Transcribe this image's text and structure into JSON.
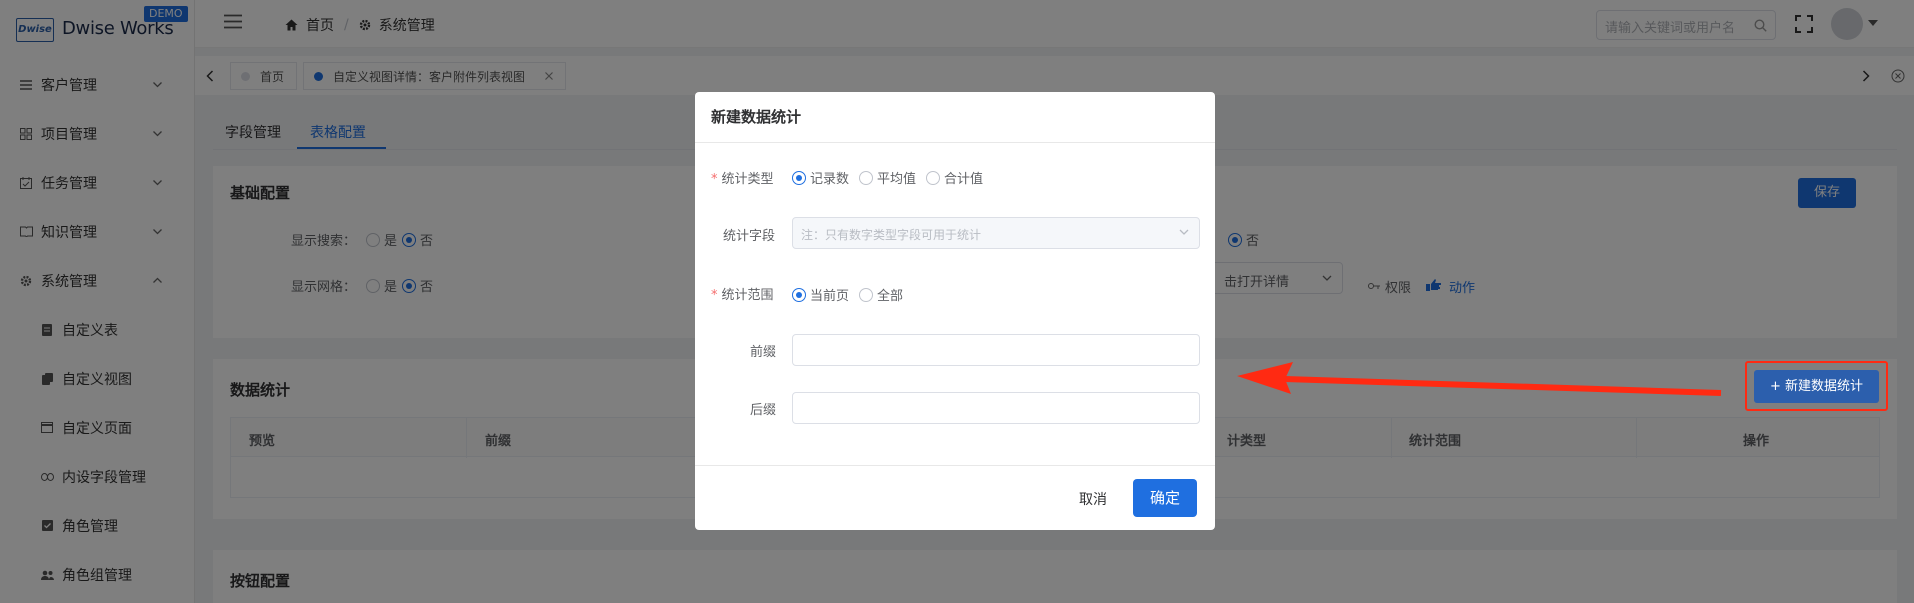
{
  "app": {
    "logo_mark": "Dwise",
    "logo_name": "Dwise Works",
    "badge": "DEMO"
  },
  "sidebar": {
    "items": [
      {
        "label": "客户管理",
        "icon": "list-icon",
        "expanded": false
      },
      {
        "label": "项目管理",
        "icon": "grid-icon",
        "expanded": false
      },
      {
        "label": "任务管理",
        "icon": "calendar-check-icon",
        "expanded": false
      },
      {
        "label": "知识管理",
        "icon": "book-icon",
        "expanded": false
      },
      {
        "label": "系统管理",
        "icon": "gear-icon",
        "expanded": true
      }
    ],
    "subitems": [
      {
        "label": "自定义表",
        "icon": "file-icon"
      },
      {
        "label": "自定义视图",
        "icon": "copy-icon"
      },
      {
        "label": "自定义页面",
        "icon": "window-icon"
      },
      {
        "label": "内设字段管理",
        "icon": "link-icon"
      },
      {
        "label": "角色管理",
        "icon": "checkbox-icon"
      },
      {
        "label": "角色组管理",
        "icon": "users-icon"
      }
    ]
  },
  "header": {
    "breadcrumb": [
      "首页",
      "系统管理"
    ],
    "search_placeholder": "请输入关键词或用户名"
  },
  "tabs": [
    {
      "label": "首页"
    },
    {
      "label": "自定义视图详情：客户附件列表视图"
    }
  ],
  "subtabs": [
    "字段管理",
    "表格配置"
  ],
  "basic": {
    "title": "基础配置",
    "save": "保存",
    "show_search": "显示搜索：",
    "show_grid": "显示网格：",
    "yes": "是",
    "no": "否",
    "right_no": "否",
    "open_detail": "击打开详情",
    "permission": "权限",
    "action": "动作"
  },
  "stats": {
    "title": "数据统计",
    "new_button": "+ 新建数据统计",
    "columns": [
      "预览",
      "前缀",
      "计类型",
      "统计范围",
      "操作"
    ]
  },
  "buttons_section": {
    "title": "按钮配置"
  },
  "modal": {
    "title": "新建数据统计",
    "type_label": "统计类型",
    "type_options": [
      "记录数",
      "平均值",
      "合计值"
    ],
    "type_selected": "记录数",
    "field_label": "统计字段",
    "field_placeholder": "注：只有数字类型字段可用于统计",
    "scope_label": "统计范围",
    "scope_options": [
      "当前页",
      "全部"
    ],
    "scope_selected": "当前页",
    "prefix_label": "前缀",
    "suffix_label": "后缀",
    "cancel": "取消",
    "confirm": "确定"
  },
  "colors": {
    "primary": "#1f6fe0",
    "annotation": "#ff2a12"
  }
}
